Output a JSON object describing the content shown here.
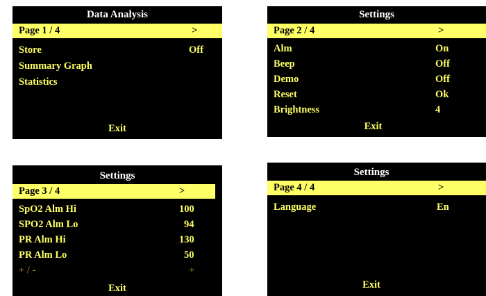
{
  "colors": {
    "screen_bg": "#000000",
    "highlight": "#ffff66",
    "text": "#ffff66",
    "title": "#ffffff",
    "dim_text": "#c9a21a"
  },
  "screen1": {
    "title": "Data Analysis",
    "page": "Page  1 / 4",
    "arrow": ">",
    "items": [
      {
        "label": "Store",
        "value": "Off"
      },
      {
        "label": "Summary Graph",
        "value": ""
      },
      {
        "label": "Statistics",
        "value": ""
      }
    ],
    "exit": "Exit"
  },
  "screen2": {
    "title": "Settings",
    "page": "Page  2 / 4",
    "arrow": ">",
    "items": [
      {
        "label": "Alm",
        "value": "On"
      },
      {
        "label": "Beep",
        "value": "Off"
      },
      {
        "label": "Demo",
        "value": "Off"
      },
      {
        "label": "Reset",
        "value": "Ok"
      },
      {
        "label": "Brightness",
        "value": "4"
      }
    ],
    "exit": "Exit"
  },
  "screen3": {
    "title": "Settings",
    "page": "Page  3 / 4",
    "arrow": ">",
    "items": [
      {
        "label": "SpO2 Alm Hi",
        "value": "100"
      },
      {
        "label": "SPO2 Alm Lo",
        "value": "94"
      },
      {
        "label": "PR Alm Hi",
        "value": "130"
      },
      {
        "label": "PR Alm Lo",
        "value": "50"
      }
    ],
    "adjust": {
      "label": "+ / -",
      "value": "+"
    },
    "exit": "Exit"
  },
  "screen4": {
    "title": "Settings",
    "page": "Page  4 / 4",
    "arrow": ">",
    "items": [
      {
        "label": "Language",
        "value": "En"
      }
    ],
    "exit": "Exit"
  }
}
